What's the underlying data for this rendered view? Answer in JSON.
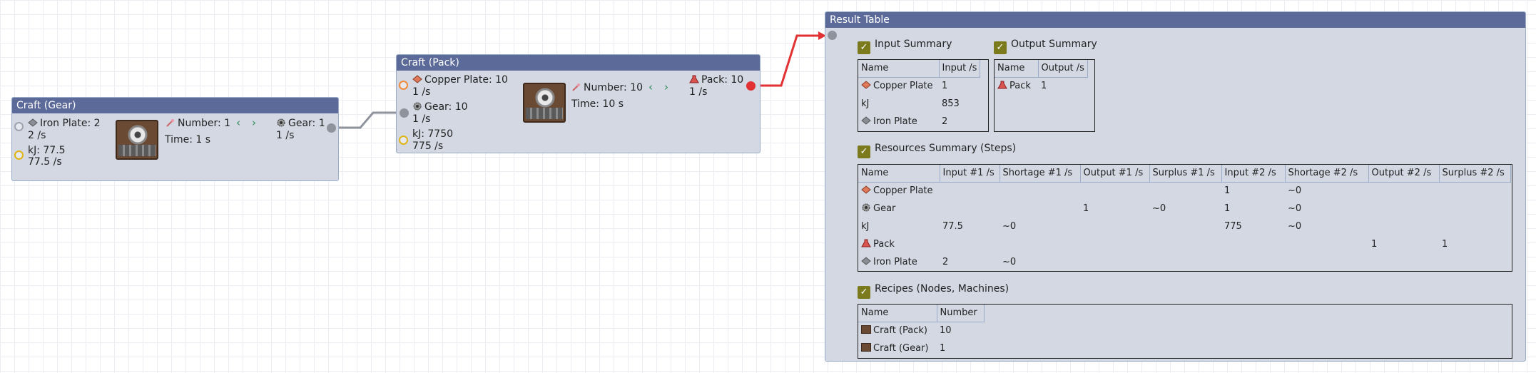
{
  "colors": {
    "header": "#5b6a99",
    "node_bg": "#d3d8e3",
    "link_gray": "#8e939c",
    "link_red": "#e23132",
    "checkbox": "#7b7a1c"
  },
  "gear_node": {
    "title": "Craft (Gear)",
    "in1_name": "Iron Plate: 2",
    "in1_rate": "2 /s",
    "in2_name": "kJ: 77.5",
    "in2_rate": "77.5 /s",
    "number": "Number: 1",
    "time": "Time:  1 s",
    "out_name": "Gear: 1",
    "out_rate": "1 /s"
  },
  "pack_node": {
    "title": "Craft (Pack)",
    "in1_name": "Copper Plate: 10",
    "in1_rate": "1 /s",
    "in2_name": "Gear: 10",
    "in2_rate": "1 /s",
    "in3_name": "kJ: 7750",
    "in3_rate": "775 /s",
    "number": "Number: 10",
    "time": "Time:  10 s",
    "out_name": "Pack: 10",
    "out_rate": "1 /s"
  },
  "result": {
    "title": "Result Table",
    "input_summary_label": "Input Summary",
    "output_summary_label": "Output Summary",
    "resources_label": "Resources Summary (Steps)",
    "recipes_label": "Recipes (Nodes, Machines)",
    "input_table": {
      "headers": [
        "Name",
        "Input /s"
      ],
      "rows": [
        {
          "icon": "copper-plate-icon",
          "name": "Copper Plate",
          "value": "1"
        },
        {
          "icon": "",
          "name": "kJ",
          "value": "853"
        },
        {
          "icon": "iron-plate-icon",
          "name": "Iron Plate",
          "value": "2"
        }
      ]
    },
    "output_table": {
      "headers": [
        "Name",
        "Output /s"
      ],
      "rows": [
        {
          "icon": "pack-icon",
          "name": "Pack",
          "value": "1"
        }
      ]
    },
    "resources_table": {
      "headers": [
        "Name",
        "Input #1 /s",
        "Shortage #1 /s",
        "Output #1 /s",
        "Surplus #1 /s",
        "Input #2 /s",
        "Shortage #2 /s",
        "Output #2 /s",
        "Surplus #2 /s"
      ],
      "rows": [
        {
          "icon": "copper-plate-icon",
          "cells": [
            "Copper Plate",
            "",
            "",
            "",
            "",
            "1",
            "~0",
            "",
            ""
          ]
        },
        {
          "icon": "gear-icon",
          "cells": [
            "Gear",
            "",
            "",
            "1",
            "~0",
            "1",
            "~0",
            "",
            ""
          ]
        },
        {
          "icon": "",
          "cells": [
            "kJ",
            "77.5",
            "~0",
            "",
            "",
            "775",
            "~0",
            "",
            ""
          ]
        },
        {
          "icon": "pack-icon",
          "cells": [
            "Pack",
            "",
            "",
            "",
            "",
            "",
            "",
            "1",
            "1"
          ]
        },
        {
          "icon": "iron-plate-icon",
          "cells": [
            "Iron Plate",
            "2",
            "~0",
            "",
            "",
            "",
            "",
            "",
            ""
          ]
        }
      ]
    },
    "recipes_table": {
      "headers": [
        "Name",
        "Number"
      ],
      "rows": [
        {
          "icon": "assembler-icon",
          "name": "Craft (Pack)",
          "value": "10"
        },
        {
          "icon": "assembler-icon",
          "name": "Craft (Gear)",
          "value": "1"
        }
      ]
    }
  }
}
